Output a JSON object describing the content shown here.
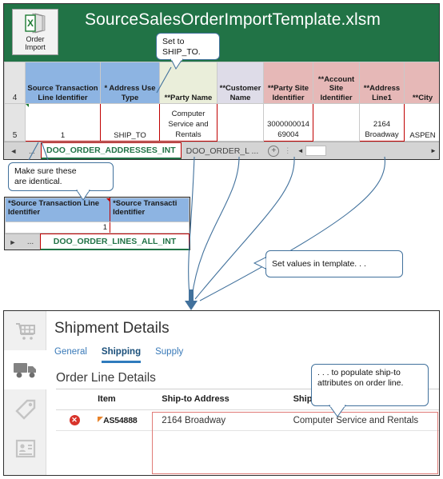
{
  "excel": {
    "filename": "SourceSalesOrderImportTemplate.xlsm",
    "ribbon_button": {
      "icon": "excel-order-import-icon",
      "line1": "Order",
      "line2": "Import"
    },
    "row_numbers": {
      "header_row": "4",
      "data_row": "5"
    },
    "columns": [
      {
        "header": "Source Transaction Line Identifier",
        "value": "1",
        "tint": "blue",
        "highlight": true
      },
      {
        "header": "* Address Use Type",
        "value": "SHIP_TO",
        "tint": "blue",
        "highlight": true
      },
      {
        "header": "**Party Name",
        "value": "Computer Service and Rentals",
        "tint": "green",
        "highlight": true
      },
      {
        "header": "**Customer Name",
        "value": "",
        "tint": "lav",
        "highlight": false
      },
      {
        "header": "**Party Site Identifier",
        "value": "300000001469004",
        "tint": "pink",
        "highlight": true
      },
      {
        "header": "**Account Site Identifier",
        "value": "",
        "tint": "pink",
        "highlight": false
      },
      {
        "header": "**Address Line1",
        "value": "2164 Broadway",
        "tint": "pink",
        "highlight": true
      },
      {
        "header": "**City",
        "value": "ASPEN",
        "tint": "pink",
        "highlight": false
      }
    ],
    "tabs": {
      "prev_arrow": "◄",
      "ellipsis": "...",
      "active_tab": "DOO_ORDER_ADDRESSES_INT",
      "inactive_tab": "DOO_ORDER_L ...",
      "add_sheet": "+",
      "more_dots": "⋮",
      "scroll_left": "◄",
      "scroll_right": "►"
    }
  },
  "lines_sheet": {
    "col1_header": "*Source Transaction Line Identifier",
    "col2_header": "*Source Transacti Identifier",
    "col1_value": "1",
    "col2_value": "",
    "tab_arrow": "►",
    "tab_ellipsis": "...",
    "tab_name": "DOO_ORDER_LINES_ALL_INT"
  },
  "callouts": {
    "ship_to": "Set to\nSHIP_TO.",
    "identical": "Make sure these\nare identical.",
    "set_values": "Set values  in template. . .",
    "populate": ". . . to populate ship-to attributes on order line."
  },
  "app": {
    "sidebar_icons": [
      "cart-icon",
      "truck-icon",
      "tag-icon",
      "contact-card-icon"
    ],
    "title": "Shipment Details",
    "tabs": [
      {
        "label": "General",
        "selected": false
      },
      {
        "label": "Shipping",
        "selected": true
      },
      {
        "label": "Supply",
        "selected": false
      }
    ],
    "section_title": "Order Line Details",
    "table": {
      "headers": [
        "",
        "Item",
        "Ship-to Address",
        "Ship-to Customer"
      ],
      "rows": [
        {
          "status": "error",
          "item": "AS54888",
          "ship_to_address": "2164 Broadway",
          "ship_to_customer": "Computer Service and Rentals"
        }
      ]
    }
  },
  "colors": {
    "excel_green": "#217346",
    "header_blue": "#8db4e2",
    "header_green": "#eaeeda",
    "header_lavender": "#dedce8",
    "header_pink": "#e6b8b7",
    "highlight_red": "#c00000",
    "callout_border": "#41719c",
    "app_blue": "#3879b8",
    "error_red": "#d8332a",
    "app_highlight_red": "#e07b77"
  }
}
